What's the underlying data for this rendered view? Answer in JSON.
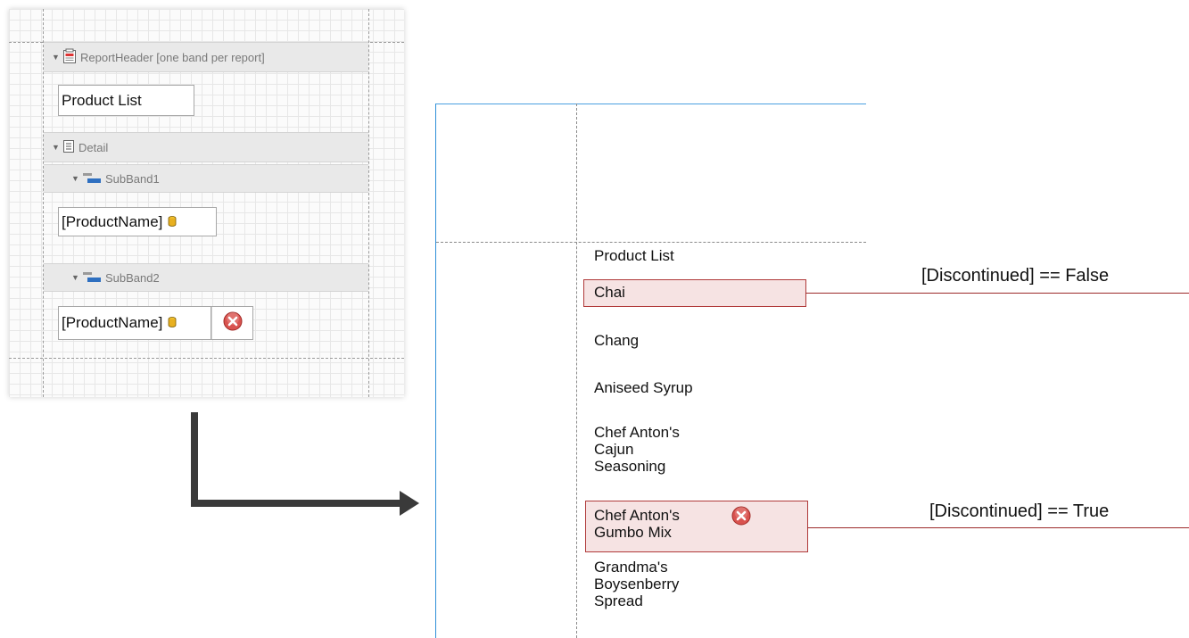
{
  "designer": {
    "report_header": "ReportHeader [one band per report]",
    "title_field": "Product List",
    "detail": "Detail",
    "subband1": "SubBand1",
    "subband1_field": "[ProductName]",
    "subband2": "SubBand2",
    "subband2_field": "[ProductName]"
  },
  "preview": {
    "title": "Product List",
    "items": [
      "Chai",
      "Chang",
      "Aniseed Syrup",
      "Chef Anton's\nCajun\nSeasoning",
      "Chef Anton's\nGumbo Mix",
      "Grandma's\nBoysenberry\nSpread"
    ],
    "condition_false": "[Discontinued] == False",
    "condition_true": "[Discontinued] == True"
  },
  "icons": {
    "expand": "triangle-down-icon",
    "report_header": "report-header-icon",
    "detail": "detail-band-icon",
    "subband": "subband-icon",
    "database": "database-field-icon",
    "discontinued": "red-x-circle-icon"
  },
  "colors": {
    "highlight_fill": "#f6e3e3",
    "highlight_border": "#b03a3a",
    "page_border": "#2f8fd8",
    "arrow": "#3a3a3a"
  }
}
